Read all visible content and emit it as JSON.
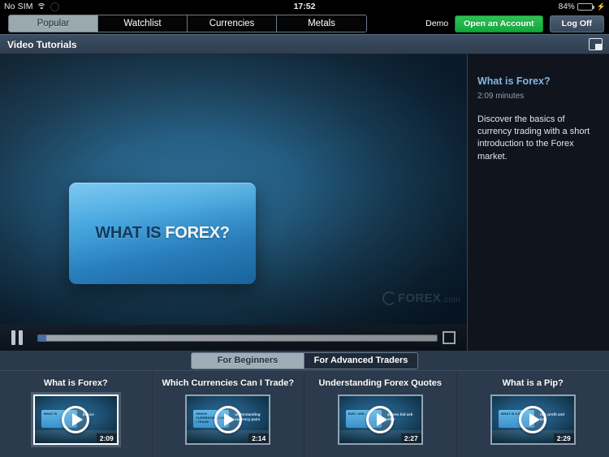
{
  "statusbar": {
    "carrier": "No SIM",
    "wifi_icon": "wifi-icon",
    "sync_icon": "sync-icon",
    "time": "17:52",
    "battery_percent": "84%",
    "battery_level": 84,
    "charging_icon": "charging-bolt-icon"
  },
  "navbar": {
    "tabs": [
      {
        "label": "Popular",
        "active": true
      },
      {
        "label": "Watchlist",
        "active": false
      },
      {
        "label": "Currencies",
        "active": false
      },
      {
        "label": "Metals",
        "active": false
      }
    ],
    "demo_label": "Demo",
    "open_account_label": "Open an Account",
    "log_off_label": "Log Off",
    "open_account_color": "#1eb448"
  },
  "titlebar": {
    "title": "Video Tutorials",
    "layout_toggle_icon": "picture-in-picture-icon"
  },
  "player": {
    "title_card_dark": "WHAT IS ",
    "title_card_light": "FOREX?",
    "watermark_brand": "FOREX",
    "watermark_suffix": ".com",
    "pause_icon": "pause-icon",
    "fullscreen_icon": "fullscreen-icon",
    "progress_percent": 2
  },
  "info": {
    "title": "What is Forex?",
    "duration": "2:09 minutes",
    "description": "Discover the basics of currency trading with a short introduction to the Forex market.",
    "title_color": "#7fb7e8"
  },
  "categories": [
    {
      "label": "For Beginners",
      "active": true
    },
    {
      "label": "For Advanced Traders",
      "active": false
    }
  ],
  "thumbnails": [
    {
      "title": "What is Forex?",
      "duration": "2:09",
      "selected": true,
      "slab_text": "WHAT IS",
      "side_text": "basics",
      "play_icon": "play-icon"
    },
    {
      "title": "Which Currencies Can I Trade?",
      "duration": "2:14",
      "selected": false,
      "slab_text": "WHICH CURRENCIES CAN I TRADE",
      "side_text": "understanding currency pairs",
      "play_icon": "play-icon"
    },
    {
      "title": "Understanding Forex Quotes",
      "duration": "2:27",
      "selected": false,
      "slab_text": "EUR / USD",
      "side_text": "quotes bid ask offer",
      "play_icon": "play-icon"
    },
    {
      "title": "What is a Pip?",
      "duration": "2:29",
      "selected": false,
      "slab_text": "WHAT IS A PIP",
      "side_text": "rate profit and loss",
      "play_icon": "play-icon"
    }
  ]
}
